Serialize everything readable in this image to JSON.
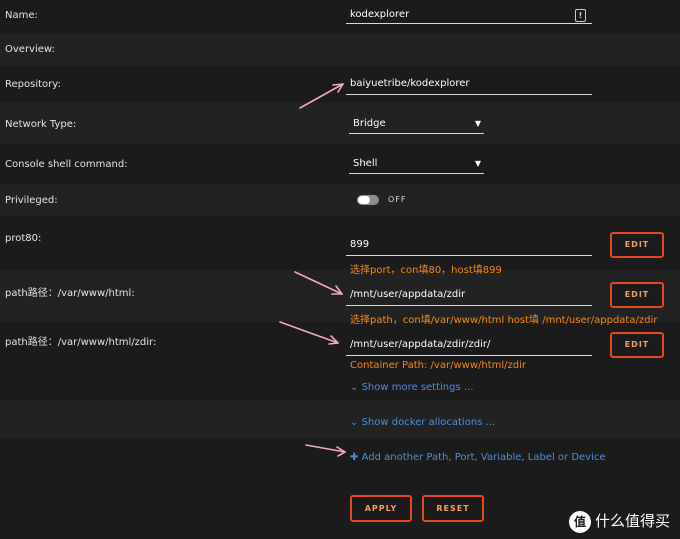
{
  "form": {
    "name": {
      "label": "Name:",
      "value": "kodexplorer"
    },
    "overview": {
      "label": "Overview:"
    },
    "repository": {
      "label": "Repository:",
      "value": "baiyuetribe/kodexplorer"
    },
    "network": {
      "label": "Network Type:",
      "value": "Bridge"
    },
    "console": {
      "label": "Console shell command:",
      "value": "Shell"
    },
    "privileged": {
      "label": "Privileged:",
      "state": "OFF"
    },
    "port": {
      "label": "prot80:",
      "value": "899",
      "hint": "选择port，con填80，host填899",
      "edit": "EDIT"
    },
    "path1": {
      "label": "path路径：/var/www/html:",
      "value": "/mnt/user/appdata/zdir",
      "hint": "选择path，con填/var/www/html host填 /mnt/user/appdata/zdir",
      "edit": "EDIT"
    },
    "path2": {
      "label": "path路径：/var/www/html/zdir:",
      "value": "/mnt/user/appdata/zdir/zdir/",
      "hint": "Container Path: /var/www/html/zdir",
      "edit": "EDIT"
    }
  },
  "links": {
    "more_settings": "Show more settings ...",
    "docker_allocations": "Show docker allocations ...",
    "add_another": "Add another Path, Port, Variable, Label or Device"
  },
  "actions": {
    "apply": "APPLY",
    "reset": "RESET"
  },
  "watermark": {
    "badge": "值",
    "text": "什么值得买"
  },
  "colors": {
    "accent": "#e2491f",
    "hint": "#f28a1a",
    "link": "#4a90d9",
    "arrow": "#f3a6c8"
  },
  "icons": {
    "caret": "▼",
    "plus": "✚",
    "chevron": "⌄",
    "alert": "!"
  }
}
